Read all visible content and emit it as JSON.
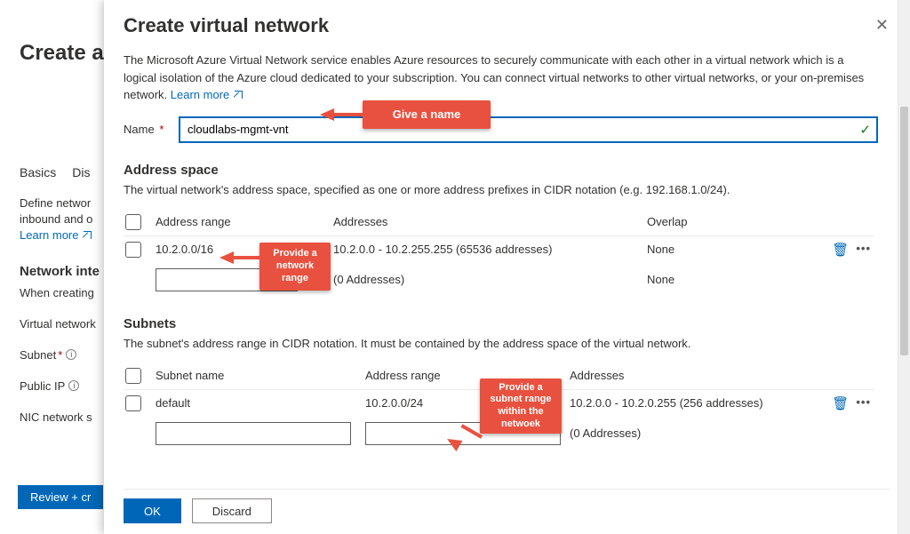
{
  "background": {
    "title": "Create a",
    "tabs": [
      "Basics",
      "Dis"
    ],
    "define_line1": "Define networ",
    "define_line2": "inbound and o",
    "learn": "Learn more",
    "network_settings": "Network inte",
    "when_creating": "When creating",
    "virtual_network": "Virtual network",
    "subnet_label": "Subnet ",
    "public_ip": "Public IP",
    "nic": "NIC network s",
    "review_btn": "Review + cr"
  },
  "blade": {
    "title": "Create virtual network",
    "description": "The Microsoft Azure Virtual Network service enables Azure resources to securely communicate with each other in a virtual network which is a logical isolation of the Azure cloud dedicated to your subscription. You can connect virtual networks to other virtual networks, or your on-premises network. ",
    "learn_more": "Learn more",
    "name_label": "Name",
    "name_value": "cloudlabs-mgmt-vnt",
    "address_space": {
      "title": "Address space",
      "desc": "The virtual network's address space, specified as one or more address prefixes in CIDR notation (e.g. 192.168.1.0/24).",
      "headers": {
        "range": "Address range",
        "addresses": "Addresses",
        "overlap": "Overlap"
      },
      "rows": [
        {
          "range": "10.2.0.0/16",
          "addresses": "10.2.0.0 - 10.2.255.255 (65536 addresses)",
          "overlap": "None"
        },
        {
          "range": "",
          "addresses": "(0 Addresses)",
          "overlap": "None"
        }
      ]
    },
    "subnets": {
      "title": "Subnets",
      "desc": "The subnet's address range in CIDR notation. It must be contained by the address space of the virtual network.",
      "headers": {
        "name": "Subnet name",
        "range": "Address range",
        "addresses": "Addresses"
      },
      "rows": [
        {
          "name": "default",
          "range": "10.2.0.0/24",
          "addresses": "10.2.0.0 - 10.2.0.255 (256 addresses)"
        },
        {
          "name": "",
          "range": "",
          "addresses": "(0 Addresses)"
        }
      ]
    },
    "buttons": {
      "ok": "OK",
      "discard": "Discard"
    }
  },
  "callouts": {
    "name": "Give a name",
    "range": "Provide a network range",
    "subnet": "Provide a subnet range within the netwoek"
  }
}
